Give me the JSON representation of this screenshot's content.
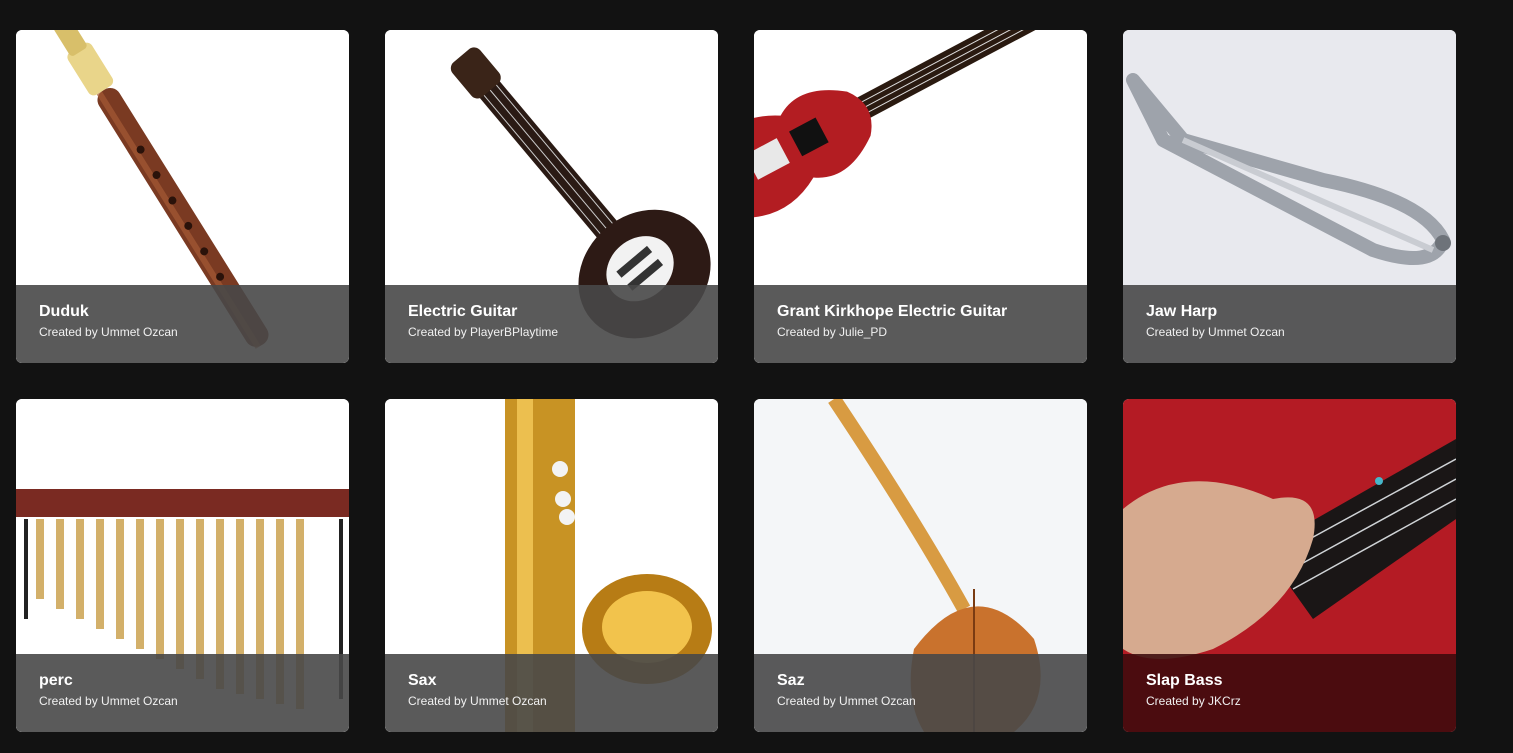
{
  "colors": {
    "background": "#121212",
    "overlay": "#484848",
    "text": "#ffffff"
  },
  "instruments": [
    {
      "title": "Duduk",
      "creator_line": "Created by Ummet Ozcan",
      "icon": "duduk-image"
    },
    {
      "title": "Electric Guitar",
      "creator_line": "Created by PlayerBPlaytime",
      "icon": "electric-guitar-image"
    },
    {
      "title": "Grant Kirkhope Electric Guitar",
      "creator_line": "Created by Julie_PD",
      "icon": "red-guitar-image"
    },
    {
      "title": "Jaw Harp",
      "creator_line": "Created by Ummet Ozcan",
      "icon": "jaw-harp-image"
    },
    {
      "title": "perc",
      "creator_line": "Created by Ummet Ozcan",
      "icon": "marimba-image"
    },
    {
      "title": "Sax",
      "creator_line": "Created by Ummet Ozcan",
      "icon": "saxophone-image"
    },
    {
      "title": "Saz",
      "creator_line": "Created by Ummet Ozcan",
      "icon": "saz-image"
    },
    {
      "title": "Slap Bass",
      "creator_line": "Created by JKCrz",
      "icon": "bass-guitar-image"
    }
  ]
}
